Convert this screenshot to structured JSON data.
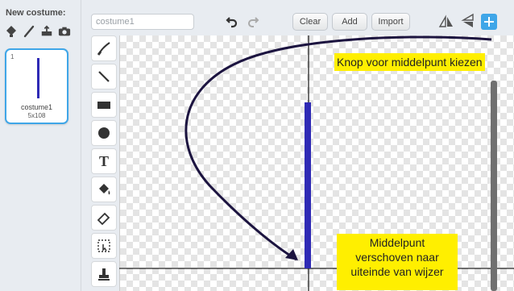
{
  "costumes_panel": {
    "new_costume_label": "New costume:",
    "new_icons": [
      "paint-new-icon",
      "brush-new-icon",
      "upload-icon",
      "camera-icon"
    ],
    "items": [
      {
        "number": "1",
        "name": "costume1",
        "size": "5x108",
        "selected": true
      }
    ]
  },
  "editor": {
    "costume_name_value": "costume1",
    "buttons": {
      "clear": "Clear",
      "add": "Add",
      "import": "Import"
    },
    "icons": [
      "undo-icon",
      "redo-icon",
      "flip-horizontal-icon",
      "flip-vertical-icon",
      "set-costume-center-icon"
    ],
    "tools": [
      "paintbrush-icon",
      "line-icon",
      "rectangle-icon",
      "ellipse-icon",
      "text-icon",
      "fill-icon",
      "eraser-icon",
      "select-icon",
      "stamp-icon"
    ]
  },
  "annotations": {
    "top_callout": "Knop voor middelpunt kiezen",
    "bottom_callout_lines": [
      "Middelpunt",
      "verschoven naar",
      "uiteinde van wijzer"
    ]
  },
  "colors": {
    "accent": "#3fa6e8",
    "callout_bg": "#ffef00",
    "sprite_line": "#2f2ab5",
    "arrow": "#1c1440"
  }
}
